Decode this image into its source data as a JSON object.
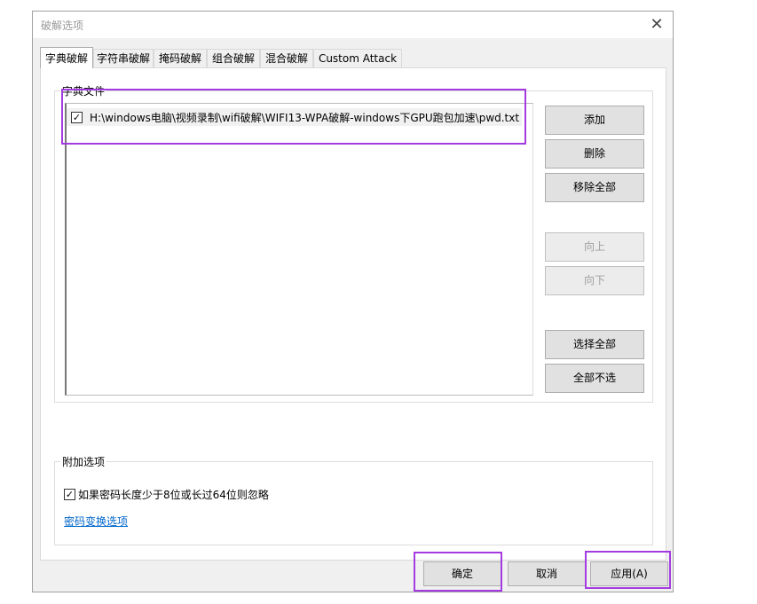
{
  "dialog": {
    "title": "破解选项",
    "close_glyph": "✕"
  },
  "tabs": [
    {
      "label": "字典破解",
      "active": true
    },
    {
      "label": "字符串破解"
    },
    {
      "label": "掩码破解"
    },
    {
      "label": "组合破解"
    },
    {
      "label": "混合破解"
    },
    {
      "label": "Custom Attack"
    }
  ],
  "dict_group": {
    "label": "字典文件",
    "files": [
      {
        "checked": true,
        "path": "H:\\windows电脑\\视频录制\\wifi破解\\WIFI13-WPA破解-windows下GPU跑包加速\\pwd.txt"
      }
    ],
    "buttons": {
      "add": "添加",
      "delete": "删除",
      "remove_all": "移除全部",
      "move_up": "向上",
      "move_down": "向下",
      "select_all": "选择全部",
      "select_none": "全部不选"
    }
  },
  "extra_group": {
    "label": "附加选项",
    "ignore_option": {
      "checked": true,
      "label": "如果密码长度少于8位或长过64位则忽略"
    },
    "link": "密码变换选项"
  },
  "footer": {
    "ok": "确定",
    "cancel": "取消",
    "apply": "应用(A)"
  },
  "colors": {
    "highlight": "#a43be0",
    "link": "#0066cc"
  },
  "check_glyph": "✓"
}
